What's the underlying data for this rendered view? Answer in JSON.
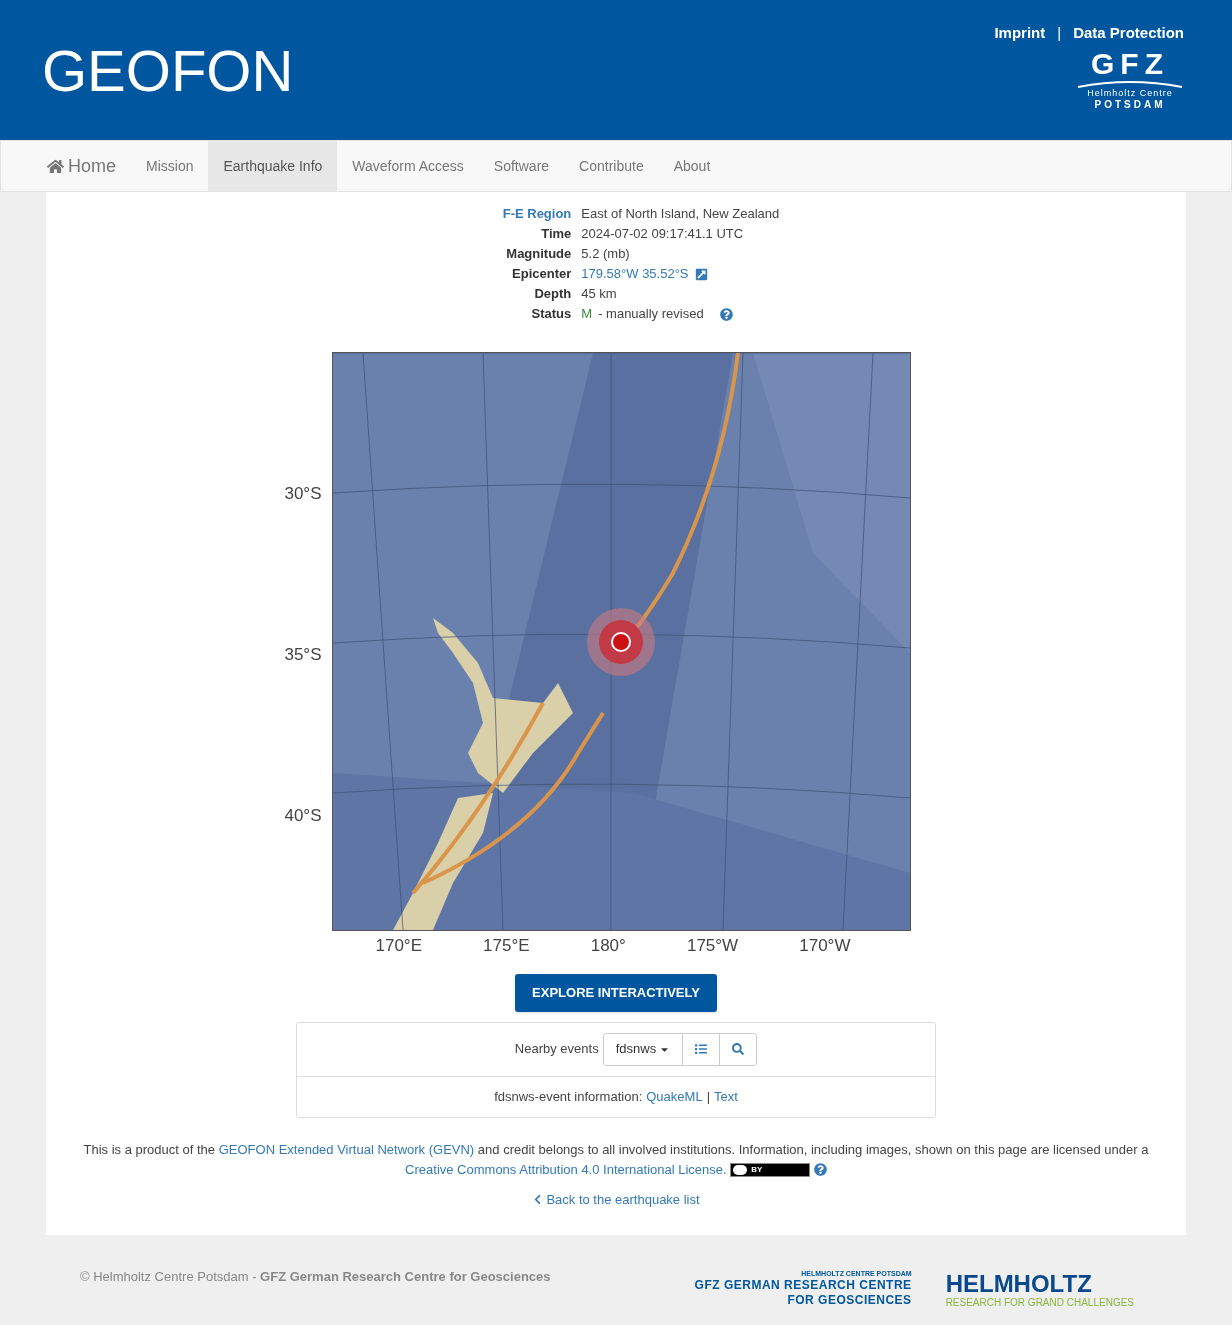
{
  "header": {
    "title": "GEOFON",
    "links": [
      "Imprint",
      "Data Protection"
    ],
    "separator": "|",
    "logo": {
      "mark": "GFZ",
      "line1": "Helmholtz Centre",
      "line2": "POTSDAM"
    }
  },
  "nav": [
    {
      "label": "Home",
      "kind": "home",
      "selected": false
    },
    {
      "label": "Mission",
      "kind": "plain",
      "selected": false
    },
    {
      "label": "Earthquake Info",
      "kind": "plain",
      "selected": true
    },
    {
      "label": "Waveform Access",
      "kind": "plain",
      "selected": false
    },
    {
      "label": "Software",
      "kind": "plain",
      "selected": false
    },
    {
      "label": "Contribute",
      "kind": "plain",
      "selected": false
    },
    {
      "label": "About",
      "kind": "plain",
      "selected": false
    }
  ],
  "event": [
    {
      "label": "F-E Region",
      "kind": "label-link",
      "value": "East of North Island, New Zealand"
    },
    {
      "label": "Time",
      "kind": "text",
      "value": "2024-07-02 09:17:41.1 UTC"
    },
    {
      "label": "Magnitude",
      "kind": "text",
      "value": "5.2 (mb)"
    },
    {
      "label": "Epicenter",
      "kind": "link",
      "value": "179.58°W 35.52°S"
    },
    {
      "label": "Depth",
      "kind": "text",
      "value": "45 km"
    },
    {
      "label": "Status",
      "kind": "status",
      "code": "M",
      "value": "- manually revised"
    }
  ],
  "map": {
    "kind": "picture",
    "lat_labels": [
      "30°S",
      "35°S",
      "40°S"
    ],
    "lon_labels": [
      "170°E",
      "175°E",
      "180°",
      "175°W",
      "170°W"
    ]
  },
  "explore_button": "EXPLORE INTERACTIVELY",
  "nearby": {
    "label": "Nearby events",
    "dropdown": "fdsnws"
  },
  "info": {
    "prefix": "fdsnws-event information:",
    "links": [
      "QuakeML",
      "Text"
    ],
    "separator": "|"
  },
  "license": {
    "before": "This is a product of the",
    "link1": "GEOFON Extended Virtual Network (GEVN)",
    "middle": "and credit belongs to all involved institutions. Information, including images, shown on this page are licensed under a",
    "link2": "Creative Commons Attribution 4.0 International License.",
    "badge": "BY"
  },
  "back_link": "Back to the earthquake list",
  "footer": {
    "copyright": "© Helmholtz Centre Potsdam - **GFZ German Research Centre for Geosciences**",
    "gfz_logo": [
      "HELMHOLTZ CENTRE POTSDAM",
      "GFZ GERMAN RESEARCH CENTRE",
      "FOR GEOSCIENCES"
    ],
    "helmholtz_logo": [
      "HELMHOLTZ",
      "RESEARCH FOR GRAND CHALLENGES"
    ]
  }
}
